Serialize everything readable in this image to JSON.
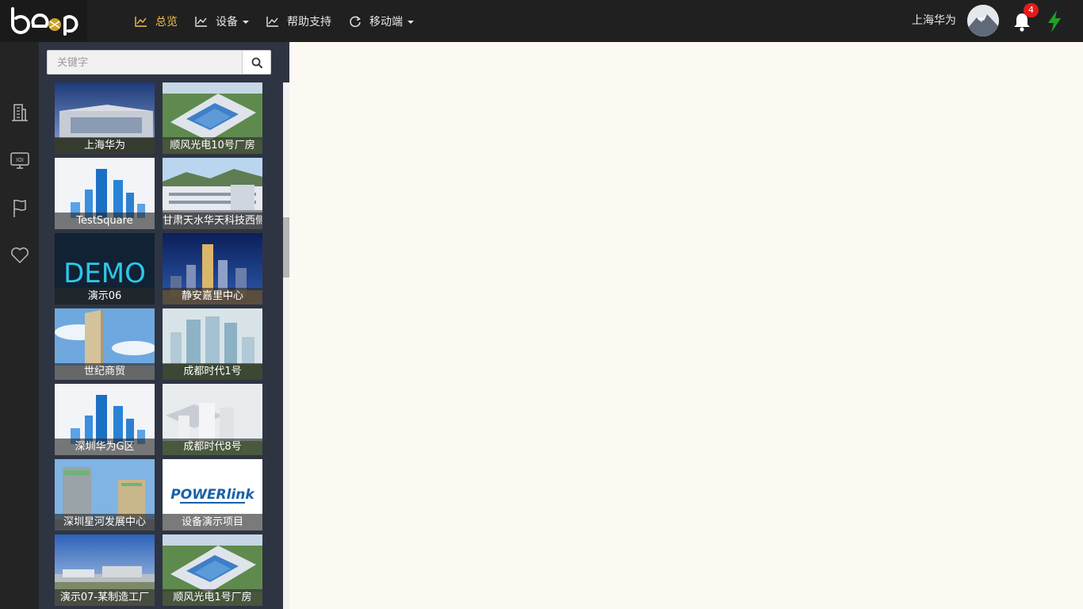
{
  "header": {
    "logo_icon": "beep-logo",
    "nav": [
      {
        "label": "总览",
        "icon": "line-chart-icon",
        "active": true,
        "dropdown": false
      },
      {
        "label": "设备",
        "icon": "line-chart-icon",
        "active": false,
        "dropdown": true
      },
      {
        "label": "帮助支持",
        "icon": "line-chart-icon",
        "active": false,
        "dropdown": false
      },
      {
        "label": "移动端",
        "icon": "refresh-icon",
        "active": false,
        "dropdown": true
      }
    ],
    "user_name": "上海华为",
    "notification_count": "4",
    "accent_color": "#f2c14e",
    "bolt_color": "#1fa12a",
    "badge_color": "#e31b1b"
  },
  "rail": {
    "icons": [
      "building-icon",
      "monitor-icon",
      "flag-icon",
      "heart-icon"
    ]
  },
  "sidebar": {
    "search_placeholder": "关键字",
    "projects": [
      {
        "label": "上海华为",
        "thumb": "building-night"
      },
      {
        "label": "顺风光电10号厂房",
        "thumb": "factory-aerial"
      },
      {
        "label": "TestSquare",
        "thumb": "towers-blue"
      },
      {
        "label": "甘肃天水华天科技西侧",
        "thumb": "factory-hills"
      },
      {
        "label": "演示06",
        "thumb": "demo-logo"
      },
      {
        "label": "静安嘉里中心",
        "thumb": "city-night"
      },
      {
        "label": "世纪商贸",
        "thumb": "tower-sky"
      },
      {
        "label": "成都时代1号",
        "thumb": "towers-green"
      },
      {
        "label": "深圳华为G区",
        "thumb": "towers-blue"
      },
      {
        "label": "成都时代8号",
        "thumb": "towers-render"
      },
      {
        "label": "深圳星河发展中心",
        "thumb": "twin-towers"
      },
      {
        "label": "设备演示项目",
        "thumb": "powerlink-logo"
      },
      {
        "label": "演示07-某制造工厂",
        "thumb": "plant-sky"
      },
      {
        "label": "顺风光电1号厂房",
        "thumb": "factory-aerial"
      }
    ],
    "demo_logo_text": "DEMO",
    "powerlink_logo_text": "POWERlink"
  }
}
